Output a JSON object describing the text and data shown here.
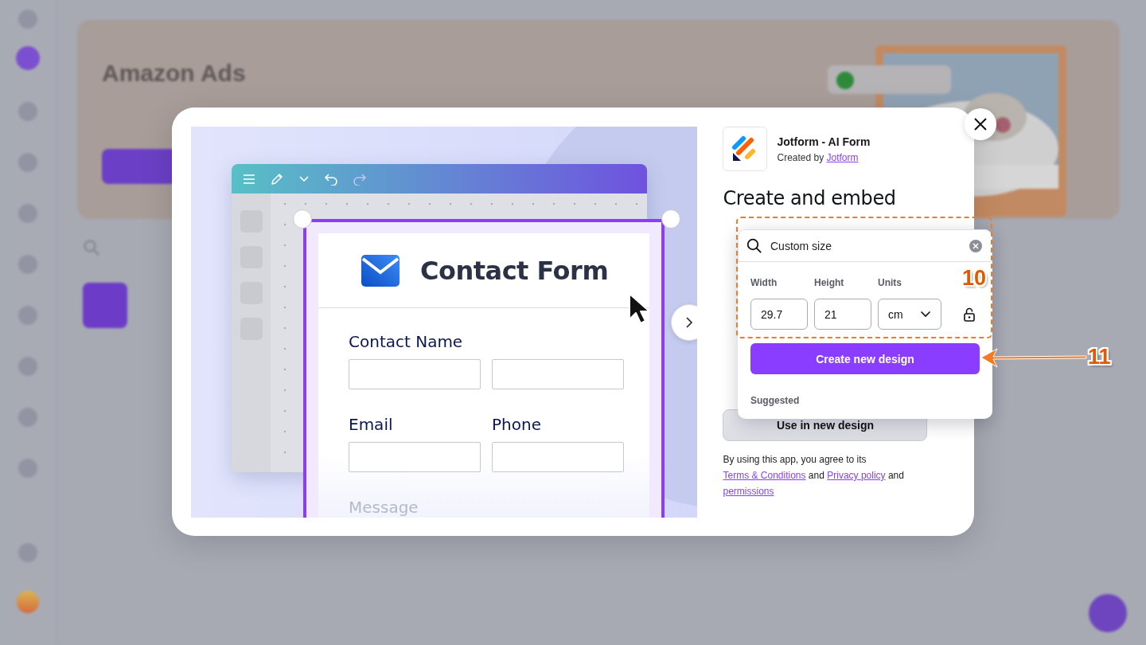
{
  "background": {
    "banner": {
      "title": "Amazon Ads"
    }
  },
  "preview": {
    "title": "Contact Form",
    "rows": [
      {
        "kind": "split",
        "labels": [
          "Contact Name"
        ]
      },
      {
        "kind": "pair",
        "labels": [
          "Email",
          "Phone"
        ]
      },
      {
        "kind": "faded",
        "labels": [
          "Message"
        ]
      }
    ]
  },
  "app": {
    "name": "Jotform - AI Form",
    "creator_prefix": "Created by",
    "creator": "Jotform",
    "heading": "Create and embed"
  },
  "popover": {
    "search_value": "Custom size",
    "fields": [
      {
        "kind": "number",
        "label": "Width",
        "value": "29.7"
      },
      {
        "kind": "number",
        "label": "Height",
        "value": "21"
      },
      {
        "kind": "select",
        "label": "Units",
        "value": "cm"
      }
    ],
    "locked": false,
    "button": "Create new design",
    "section": "Suggested"
  },
  "use_button": "Use in new design",
  "terms": [
    {
      "kind": "text",
      "text": "By using this app, you agree to its "
    },
    {
      "kind": "link",
      "text": "Terms & Conditions"
    },
    {
      "kind": "text",
      "text": " and "
    },
    {
      "kind": "link",
      "text": "Privacy policy"
    },
    {
      "kind": "text",
      "text": " and "
    },
    {
      "kind": "link",
      "text": "permissions"
    }
  ],
  "annotations": [
    {
      "kind": "outline",
      "label": "10"
    },
    {
      "kind": "arrow",
      "label": "11"
    }
  ]
}
